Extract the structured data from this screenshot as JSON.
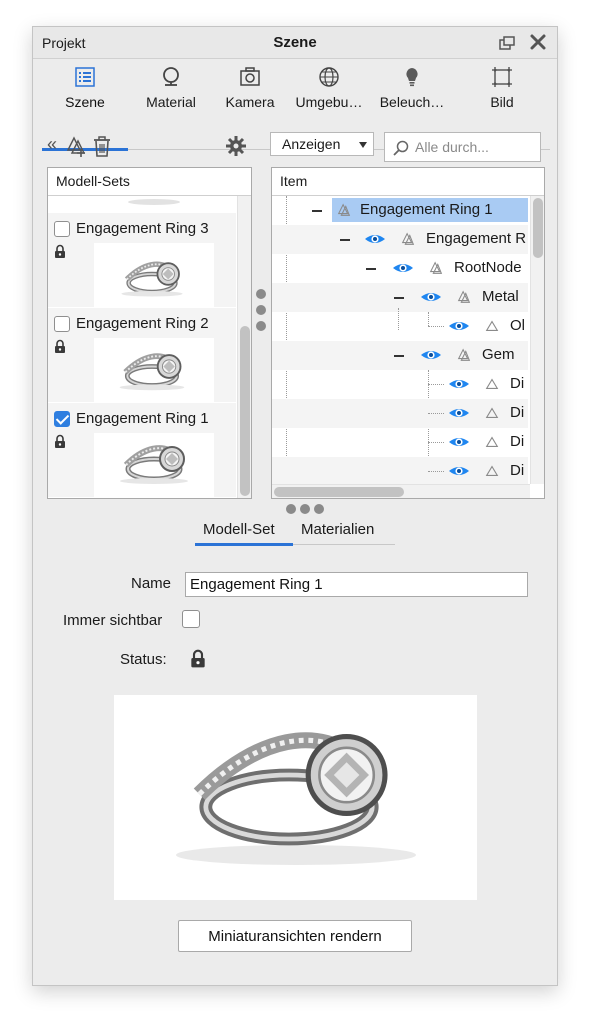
{
  "window": {
    "left_title": "Projekt",
    "center_title": "Szene"
  },
  "tabs": [
    {
      "label": "Szene",
      "icon": "list-icon",
      "active": true
    },
    {
      "label": "Material",
      "icon": "material-icon",
      "active": false
    },
    {
      "label": "Kamera",
      "icon": "camera-icon",
      "active": false
    },
    {
      "label": "Umgebu…",
      "icon": "globe-icon",
      "active": false
    },
    {
      "label": "Beleuch…",
      "icon": "bulb-icon",
      "active": false
    },
    {
      "label": "Bild",
      "icon": "frame-icon",
      "active": false
    }
  ],
  "toolbar": {
    "collapse_glyph": "«",
    "dropdown_label": "Anzeigen",
    "search_placeholder": "Alle durch..."
  },
  "model_sets": {
    "header": "Modell-Sets",
    "items": [
      {
        "label": "Engagement Ring 3",
        "checked": false,
        "locked": true
      },
      {
        "label": "Engagement Ring 2",
        "checked": false,
        "locked": true
      },
      {
        "label": "Engagement Ring 1",
        "checked": true,
        "locked": true
      }
    ]
  },
  "tree": {
    "header": "Item",
    "rows": [
      {
        "label": "Engagement Ring 1",
        "eye": false,
        "selected": true
      },
      {
        "label": "Engagement R",
        "eye": true,
        "selected": false
      },
      {
        "label": "RootNode",
        "eye": true,
        "selected": false
      },
      {
        "label": "Metal",
        "eye": true,
        "selected": false
      },
      {
        "label": "Ol",
        "eye": true,
        "selected": false
      },
      {
        "label": "Gem",
        "eye": true,
        "selected": false
      },
      {
        "label": "Di",
        "eye": true,
        "selected": false
      },
      {
        "label": "Di",
        "eye": true,
        "selected": false
      },
      {
        "label": "Di",
        "eye": true,
        "selected": false
      },
      {
        "label": "Di",
        "eye": true,
        "selected": false
      }
    ]
  },
  "subtabs": [
    {
      "label": "Modell-Set",
      "active": true
    },
    {
      "label": "Materialien",
      "active": false
    }
  ],
  "form": {
    "name_label": "Name",
    "name_value": "Engagement Ring 1",
    "visible_label": "Immer sichtbar",
    "visible_checked": false,
    "status_label": "Status:",
    "status_icon": "lock-icon"
  },
  "render_button": "Miniaturansichten rendern",
  "colors": {
    "accent": "#2b73d6",
    "selection": "#a9cbf3",
    "eye": "#1f86f0"
  }
}
